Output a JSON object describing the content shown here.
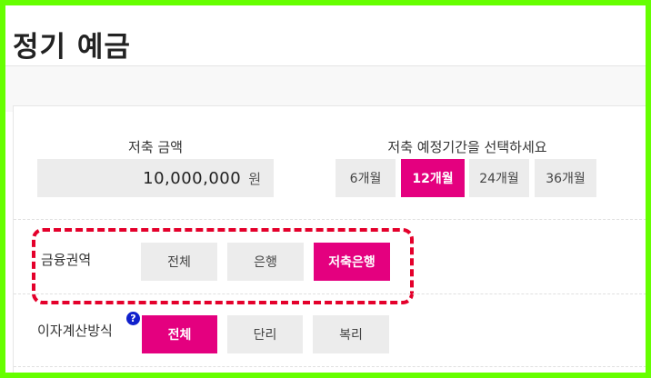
{
  "page": {
    "title": "정기 예금"
  },
  "amount": {
    "label": "저축 금액",
    "value": "10,000,000",
    "unit": "원"
  },
  "period": {
    "label": "저축 예정기간을 선택하세요",
    "options": [
      "6개월",
      "12개월",
      "24개월",
      "36개월"
    ],
    "selected": "12개월"
  },
  "sector": {
    "label": "금융권역",
    "options": [
      "전체",
      "은행",
      "저축은행"
    ],
    "selected": "저축은행"
  },
  "interest": {
    "label": "이자계산방식",
    "help_icon": "?",
    "options": [
      "전체",
      "단리",
      "복리"
    ],
    "selected": "전체"
  },
  "colors": {
    "accent": "#e4007f",
    "highlight_border": "#e4002b",
    "frame": "#66ff00",
    "help_icon": "#1020cc"
  }
}
